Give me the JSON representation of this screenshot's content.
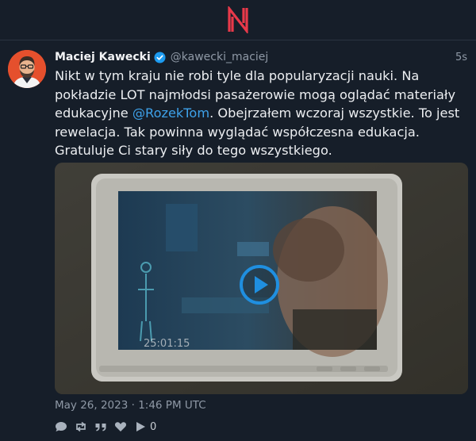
{
  "app": {
    "logo_icon": "nitter-logo-icon",
    "accent": "#e8394a"
  },
  "tweet": {
    "author_name": "Maciej Kawecki",
    "author_handle": "@kawecki_maciej",
    "verified": true,
    "time_ago": "5s",
    "text_parts": {
      "before_mention": "Nikt w tym kraju nie robi tyle dla popularyzacji nauki. Na pokładzie LOT najmłodsi pasażerowie mogą oglądać materiały edukacyjne ",
      "mention": "@RozekTom",
      "after_mention": ". Obejrzałem wczoraj wszystkie. To jest rewelacja. Tak powinna wyglądać współczesna edukacja. Gratuluje Ci stary siły do tego wszystkiego."
    },
    "media": {
      "type": "video",
      "overlay_timestamp": "25:01:15",
      "play_icon": "play-icon"
    },
    "date": "May 26, 2023 · 1:46 PM UTC",
    "stats": {
      "views": "0"
    },
    "action_icons": [
      "comment-icon",
      "retweet-icon",
      "quote-icon",
      "heart-icon",
      "play-icon"
    ],
    "mention_color": "#3ea2ea",
    "verified_color": "#1d9bf0"
  }
}
